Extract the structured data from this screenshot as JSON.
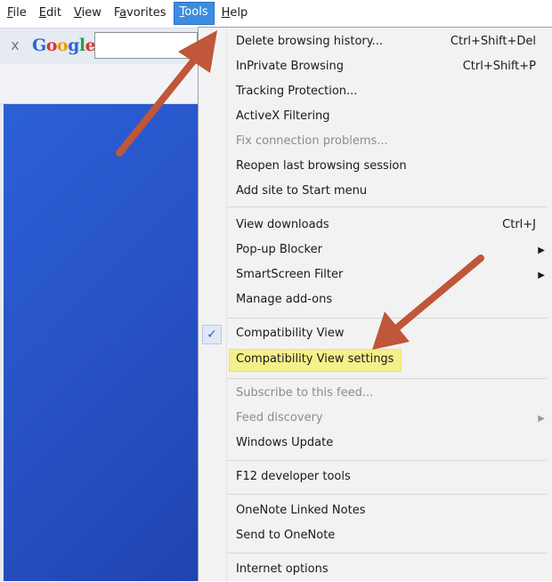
{
  "menubar": {
    "items": [
      {
        "mnemonic": "F",
        "rest": "ile"
      },
      {
        "mnemonic": "E",
        "rest": "dit"
      },
      {
        "mnemonic": "V",
        "rest": "iew"
      },
      {
        "mnemonic": "a",
        "pre": "F",
        "rest": "vorites"
      },
      {
        "mnemonic": "T",
        "rest": "ools"
      },
      {
        "mnemonic": "H",
        "rest": "elp"
      }
    ]
  },
  "toolbar": {
    "close_glyph": "x",
    "logo": {
      "g1": "G",
      "o1": "o",
      "o2": "o",
      "g2": "g",
      "l": "l",
      "e": "e"
    },
    "search_value": ""
  },
  "tools_menu": {
    "items": [
      {
        "label": "Delete browsing history...",
        "shortcut": "Ctrl+Shift+Del"
      },
      {
        "label": "InPrivate Browsing",
        "shortcut": "Ctrl+Shift+P"
      },
      {
        "label": "Tracking Protection..."
      },
      {
        "label": "ActiveX Filtering"
      },
      {
        "label": "Fix connection problems...",
        "disabled": true
      },
      {
        "label": "Reopen last browsing session"
      },
      {
        "label": "Add site to Start menu"
      },
      {
        "label": "View downloads",
        "shortcut": "Ctrl+J"
      },
      {
        "label": "Pop-up Blocker",
        "submenu": true
      },
      {
        "label": "SmartScreen Filter",
        "submenu": true
      },
      {
        "label": "Manage add-ons"
      },
      {
        "label": "Compatibility View",
        "checked": true
      },
      {
        "label": "Compatibility View settings",
        "highlighted": true
      },
      {
        "label": "Subscribe to this feed...",
        "disabled": true
      },
      {
        "label": "Feed discovery",
        "disabled": true,
        "submenu": true
      },
      {
        "label": "Windows Update"
      },
      {
        "label": "F12 developer tools"
      },
      {
        "label": "OneNote Linked Notes"
      },
      {
        "label": "Send to OneNote"
      },
      {
        "label": "Internet options"
      }
    ],
    "check_glyph": "✓",
    "submenu_glyph": "▶"
  },
  "colors": {
    "active_menu": "#3c8de0",
    "highlight": "#f4f08a",
    "arrow": "#c0563a",
    "page_blue": "#2c5fd6"
  }
}
